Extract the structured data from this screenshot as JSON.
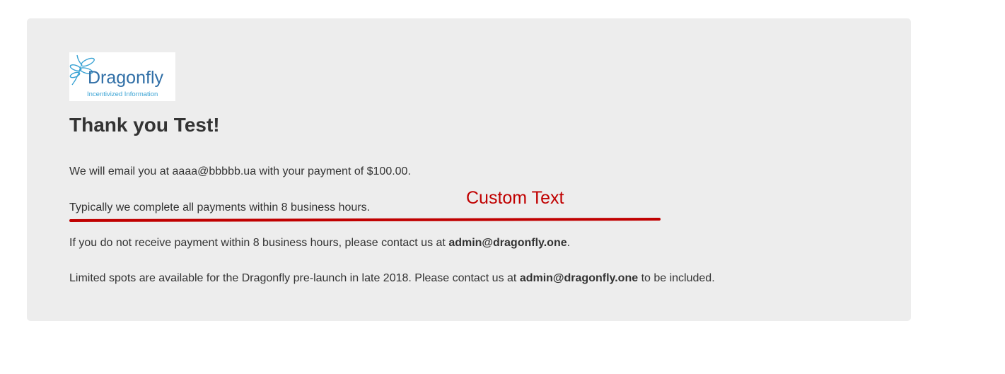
{
  "logo": {
    "name": "Dragonfly",
    "tagline": "Incentivized Information",
    "colors": {
      "wordmark": "#2f6ea6",
      "tagline": "#3aa3d4"
    }
  },
  "heading": "Thank you Test!",
  "messages": {
    "line1": "We will email you at aaaa@bbbbb.ua with your payment of $100.00.",
    "line2": "Typically we complete all payments within 8 business hours.",
    "line3_prefix": "If you do not receive payment within 8 business hours, please contact us at ",
    "line3_email": "admin@dragonfly.one",
    "line3_suffix": ".",
    "line4_prefix": "Limited spots are available for the Dragonfly pre-launch in late 2018. Please contact us at ",
    "line4_email": "admin@dragonfly.one",
    "line4_suffix": " to be included."
  },
  "annotation": {
    "label": "Custom Text",
    "color": "#c00000"
  },
  "colors": {
    "card_background": "#ededed",
    "text": "#333333"
  }
}
